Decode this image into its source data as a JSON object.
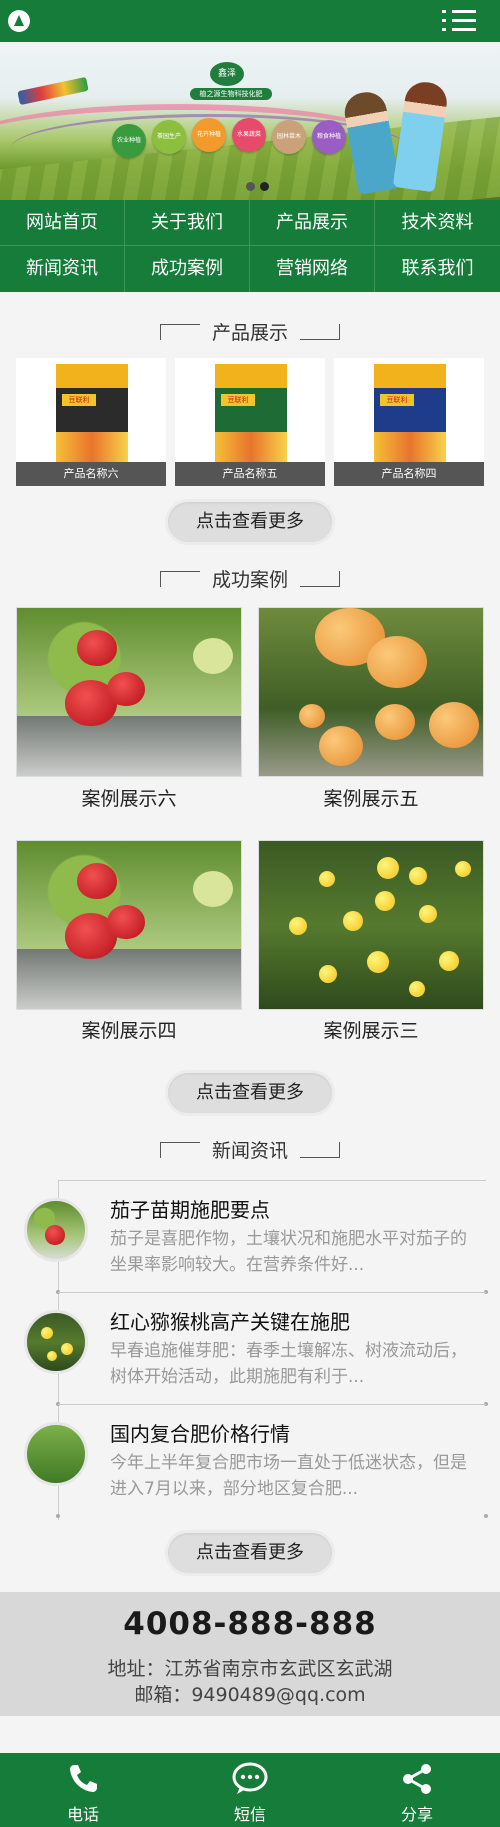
{
  "header": {
    "logo_icon": "leaf-logo-icon",
    "menu_icon": "hamburger-menu-icon"
  },
  "banner": {
    "brand": "鑫泽",
    "slogan": "植之源生物科技化肥",
    "categories": [
      "农业种植",
      "茶园生产",
      "花卉种植",
      "水果蔬菜",
      "园林苗木",
      "粮食种植"
    ],
    "category_colors": [
      "#3a9a3e",
      "#8cbf3f",
      "#f39a2c",
      "#e84a6b",
      "#c9a27a",
      "#9a5ec2"
    ]
  },
  "nav": [
    "网站首页",
    "关于我们",
    "产品展示",
    "技术资料",
    "新闻资讯",
    "成功案例",
    "营销网络",
    "联系我们"
  ],
  "products": {
    "title": "产品展示",
    "items": [
      {
        "name": "产品名称六",
        "color": "#2b2b2b",
        "brand": "豆联利"
      },
      {
        "name": "产品名称五",
        "color": "#1f6b36",
        "brand": "豆联利"
      },
      {
        "name": "产品名称四",
        "color": "#1f3c8a",
        "brand": "豆联利"
      }
    ],
    "more": "点击查看更多"
  },
  "cases": {
    "title": "成功案例",
    "items": [
      "案例展示六",
      "案例展示五",
      "案例展示四",
      "案例展示三"
    ],
    "more": "点击查看更多"
  },
  "news": {
    "title": "新闻资讯",
    "items": [
      {
        "title": "茄子苗期施肥要点",
        "desc": "茄子是喜肥作物，土壤状况和施肥水平对茄子的坐果率影响较大。在营养条件好..."
      },
      {
        "title": "红心猕猴桃高产关键在施肥",
        "desc": "早春追施催芽肥：春季土壤解冻、树液流动后，树体开始活动，此期施肥有利于..."
      },
      {
        "title": "国内复合肥价格行情",
        "desc": "今年上半年复合肥市场一直处于低迷状态，但是进入7月以来，部分地区复合肥..."
      }
    ],
    "more": "点击查看更多"
  },
  "contact": {
    "phone": "4008-888-888",
    "address": "地址：江苏省南京市玄武区玄武湖",
    "email": "邮箱：9490489@qq.com"
  },
  "bottom_bar": {
    "call": "电话",
    "sms": "短信",
    "share": "分享"
  },
  "colors": {
    "primary": "#167c3a",
    "contact_bg": "#d8d8d8"
  }
}
